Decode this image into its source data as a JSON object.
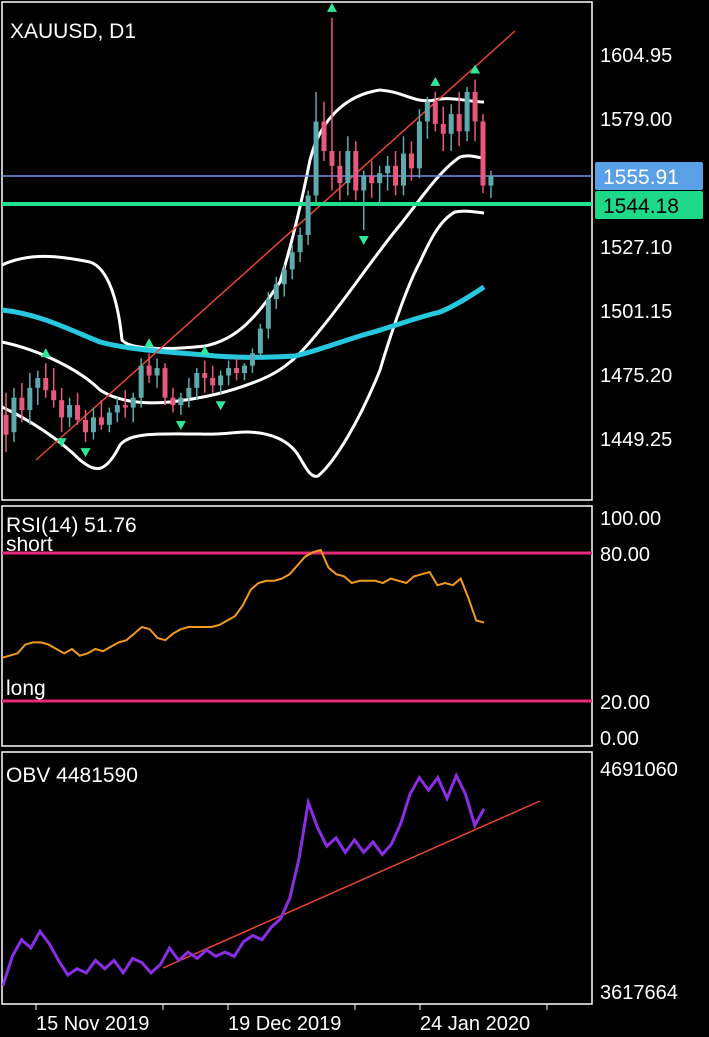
{
  "colors": {
    "background": "#000000",
    "panel_border": "#ffffff",
    "bull_candle": "#5ea9ad",
    "bear_candle": "#e8577e",
    "bollinger": "#ffffff",
    "moving_average": "#27c8de",
    "trendline": "#e8472e",
    "fractal_arrow": "#2ee89a",
    "current_price_line": "#6f8fe8",
    "current_price_tag": "#5aa0e6",
    "support_line": "#20e08c",
    "support_tag": "#1fd98a",
    "rsi_line": "#f29a1e",
    "rsi_level_line": "#e8287a",
    "obv_line": "#8a2ee6"
  },
  "main": {
    "symbol_label": "XAUUSD, D1",
    "price_ticks": [
      "1604.95",
      "1579.00",
      "1527.10",
      "1501.15",
      "1475.20",
      "1449.25"
    ],
    "current_price": "1555.91",
    "support_price": "1544.18"
  },
  "rsi": {
    "label": "RSI(14) 51.76",
    "ticks": [
      "100.00",
      "80.00",
      "20.00",
      "0.00"
    ],
    "level_labels": [
      "short",
      "long"
    ]
  },
  "obv": {
    "label": "OBV 4481590",
    "ticks": [
      "4691060",
      "3617664"
    ]
  },
  "date_ticks": [
    "15 Nov 2019",
    "19 Dec 2019",
    "24 Jan 2020"
  ],
  "chart_data": [
    {
      "type": "candlestick",
      "title": "XAUUSD, D1",
      "ylim": [
        1420,
        1625
      ],
      "fields": [
        "open",
        "high",
        "low",
        "close"
      ],
      "candles": [
        [
          1459,
          1468,
          1444,
          1451
        ],
        [
          1452,
          1470,
          1448,
          1466
        ],
        [
          1466,
          1472,
          1456,
          1461
        ],
        [
          1461,
          1476,
          1455,
          1470
        ],
        [
          1470,
          1477,
          1463,
          1474
        ],
        [
          1474,
          1480,
          1466,
          1469
        ],
        [
          1469,
          1478,
          1462,
          1465
        ],
        [
          1465,
          1470,
          1452,
          1458
        ],
        [
          1458,
          1466,
          1454,
          1463
        ],
        [
          1463,
          1468,
          1455,
          1457
        ],
        [
          1457,
          1461,
          1448,
          1452
        ],
        [
          1452,
          1462,
          1449,
          1458
        ],
        [
          1458,
          1465,
          1453,
          1455
        ],
        [
          1455,
          1462,
          1452,
          1460
        ],
        [
          1460,
          1466,
          1456,
          1463
        ],
        [
          1463,
          1469,
          1458,
          1462
        ],
        [
          1462,
          1468,
          1456,
          1466
        ],
        [
          1466,
          1482,
          1462,
          1479
        ],
        [
          1479,
          1484,
          1472,
          1475
        ],
        [
          1475,
          1482,
          1470,
          1478
        ],
        [
          1478,
          1480,
          1463,
          1466
        ],
        [
          1466,
          1470,
          1460,
          1463
        ],
        [
          1463,
          1468,
          1459,
          1466
        ],
        [
          1466,
          1474,
          1462,
          1470
        ],
        [
          1470,
          1478,
          1465,
          1476
        ],
        [
          1476,
          1481,
          1468,
          1474
        ],
        [
          1474,
          1479,
          1468,
          1471
        ],
        [
          1471,
          1477,
          1467,
          1475
        ],
        [
          1475,
          1481,
          1471,
          1478
        ],
        [
          1478,
          1482,
          1473,
          1476
        ],
        [
          1476,
          1480,
          1473,
          1479
        ],
        [
          1479,
          1486,
          1476,
          1484
        ],
        [
          1484,
          1496,
          1482,
          1494
        ],
        [
          1494,
          1509,
          1490,
          1506
        ],
        [
          1506,
          1515,
          1502,
          1512
        ],
        [
          1512,
          1520,
          1507,
          1518
        ],
        [
          1518,
          1528,
          1514,
          1525
        ],
        [
          1525,
          1535,
          1521,
          1532
        ],
        [
          1532,
          1550,
          1528,
          1548
        ],
        [
          1548,
          1590,
          1545,
          1578
        ],
        [
          1578,
          1586,
          1562,
          1566
        ],
        [
          1566,
          1620,
          1550,
          1560
        ],
        [
          1560,
          1566,
          1546,
          1553
        ],
        [
          1553,
          1572,
          1548,
          1566
        ],
        [
          1566,
          1570,
          1546,
          1550
        ],
        [
          1550,
          1558,
          1534,
          1556
        ],
        [
          1556,
          1562,
          1547,
          1553
        ],
        [
          1553,
          1560,
          1544,
          1557
        ],
        [
          1557,
          1564,
          1550,
          1560
        ],
        [
          1560,
          1566,
          1548,
          1552
        ],
        [
          1552,
          1572,
          1548,
          1565
        ],
        [
          1565,
          1570,
          1554,
          1559
        ],
        [
          1559,
          1583,
          1555,
          1578
        ],
        [
          1578,
          1588,
          1571,
          1586
        ],
        [
          1586,
          1590,
          1574,
          1577
        ],
        [
          1577,
          1584,
          1566,
          1573
        ],
        [
          1573,
          1585,
          1566,
          1581
        ],
        [
          1581,
          1590,
          1568,
          1574
        ],
        [
          1574,
          1592,
          1570,
          1590
        ],
        [
          1590,
          1595,
          1570,
          1578
        ],
        [
          1578,
          1581,
          1549,
          1552
        ],
        [
          1552,
          1558,
          1547,
          1556
        ]
      ],
      "overlays": [
        "Bollinger Bands (upper, middle, lower)",
        "Moving Average",
        "Trendline"
      ]
    },
    {
      "type": "line",
      "title": "RSI(14) 51.76",
      "ylim": [
        0,
        100
      ],
      "levels": [
        80,
        20
      ],
      "values": [
        36,
        37,
        38,
        42,
        43,
        43,
        42,
        40,
        38,
        40,
        37,
        38,
        40,
        39,
        41,
        43,
        44,
        47,
        50,
        49,
        45,
        44,
        47,
        49,
        50,
        50,
        50,
        50,
        51,
        53,
        55,
        60,
        67,
        70,
        71,
        71,
        72,
        74,
        78,
        82,
        84,
        85,
        77,
        74,
        73,
        70,
        71,
        71,
        71,
        70,
        72,
        71,
        70,
        73,
        74,
        75,
        69,
        70,
        69,
        72,
        63,
        53,
        52
      ]
    },
    {
      "type": "line",
      "title": "OBV 4481590",
      "ylim": [
        3617664,
        4691060
      ],
      "values": [
        3640000,
        3780000,
        3860000,
        3820000,
        3900000,
        3840000,
        3760000,
        3690000,
        3720000,
        3700000,
        3760000,
        3720000,
        3760000,
        3700000,
        3770000,
        3750000,
        3700000,
        3740000,
        3820000,
        3760000,
        3800000,
        3770000,
        3810000,
        3780000,
        3800000,
        3780000,
        3850000,
        3880000,
        3860000,
        3920000,
        3960000,
        4060000,
        4250000,
        4520000,
        4400000,
        4310000,
        4350000,
        4280000,
        4340000,
        4280000,
        4330000,
        4270000,
        4320000,
        4420000,
        4560000,
        4640000,
        4580000,
        4640000,
        4540000,
        4650000,
        4560000,
        4410000,
        4490000
      ]
    }
  ]
}
